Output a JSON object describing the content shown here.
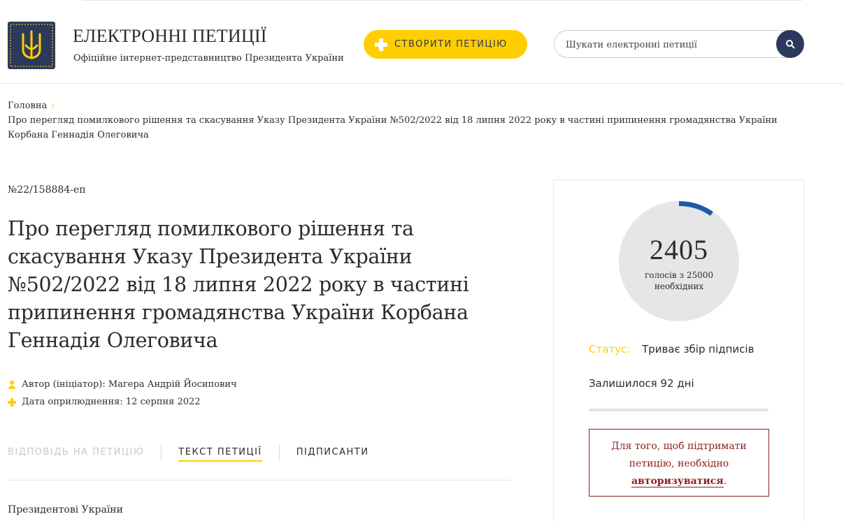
{
  "header": {
    "site_title": "ЕЛЕКТРОННІ ПЕТИЦІЇ",
    "site_subtitle": "Офіційне інтернет-представництво Президента України",
    "create_button_label": "СТВОРИТИ ПЕТИЦІЮ",
    "search_placeholder": "Шукати електронні петиції"
  },
  "breadcrumb": {
    "home": "Головна",
    "current": "Про перегляд помилкового рішення та скасування Указу Президента України №502/2022 від 18 липня 2022 року в частині припинення громадянства України Корбана Геннадія Олеговича"
  },
  "petition": {
    "number": "№22/158884-еп",
    "title": "Про перегляд помилкового рішення та скасування Указу Президента України №502/2022 від 18 липня 2022 року в частині припинення громадянства України Корбана Геннадія Олеговича",
    "author": "Автор (ініціатор): Магера Андрій Йосипович",
    "date": "Дата оприлюднення: 12 серпня 2022",
    "body_start": "Президентові України"
  },
  "tabs": [
    {
      "label": "ВІДПОВІДЬ НА ПЕТИЦІЮ",
      "state": "disabled"
    },
    {
      "label": "ТЕКСТ ПЕТИЦІЇ",
      "state": "active"
    },
    {
      "label": "ПІДПИСАНТИ",
      "state": "normal"
    }
  ],
  "sidebar": {
    "votes": 2405,
    "votes_needed": 25000,
    "votes_display": "2405",
    "votes_caption": "голосів з 25000 необхідних",
    "status_label": "Статус:",
    "status_value": "Триває збір підписів",
    "remaining": "Залишилося 92 дні",
    "auth_text_before": "Для того, щоб підтримати петицію, необхідно",
    "auth_link": "авторизуватися",
    "auth_text_after": "."
  },
  "colors": {
    "accent": "#ffce00",
    "navy": "#2b3a5c",
    "progress_arc": "#1c5aa8",
    "alert": "#8b1e1e"
  }
}
